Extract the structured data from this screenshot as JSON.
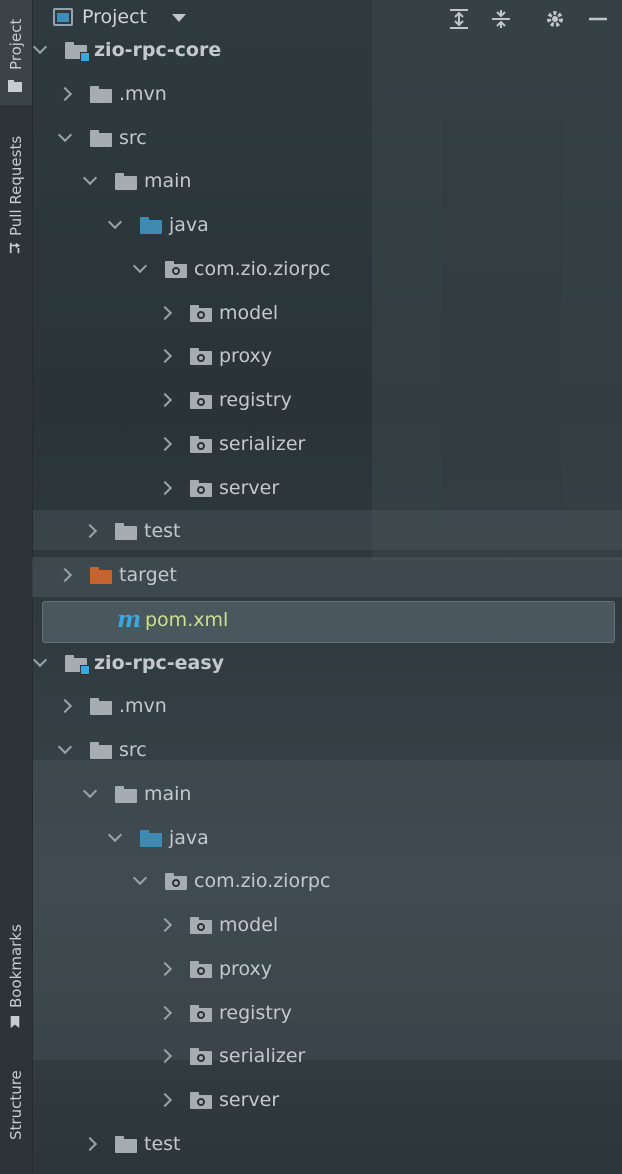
{
  "window": {
    "title": "Project"
  },
  "side_tabs": {
    "project": "Project",
    "pull_requests": "Pull Requests",
    "bookmarks": "Bookmarks",
    "structure": "Structure"
  },
  "header": {
    "icons": [
      "expand-all-icon",
      "collapse-all-icon",
      "gear-icon",
      "minimize-icon"
    ]
  },
  "tree": [
    {
      "label": "zio-rpc-core",
      "kind": "module",
      "expanded": true
    },
    {
      "label": ".mvn",
      "kind": "folder",
      "expanded": false
    },
    {
      "label": "src",
      "kind": "folder",
      "expanded": true
    },
    {
      "label": "main",
      "kind": "folder",
      "expanded": true
    },
    {
      "label": "java",
      "kind": "source-folder",
      "expanded": true
    },
    {
      "label": "com.zio.ziorpc",
      "kind": "package",
      "expanded": true
    },
    {
      "label": "model",
      "kind": "package",
      "expanded": false
    },
    {
      "label": "proxy",
      "kind": "package",
      "expanded": false
    },
    {
      "label": "registry",
      "kind": "package",
      "expanded": false
    },
    {
      "label": "serializer",
      "kind": "package",
      "expanded": false
    },
    {
      "label": "server",
      "kind": "package",
      "expanded": false
    },
    {
      "label": "test",
      "kind": "folder",
      "expanded": false
    },
    {
      "label": "target",
      "kind": "excluded-folder",
      "expanded": false
    },
    {
      "label": "pom.xml",
      "kind": "maven-file",
      "selected": true,
      "icon_glyph": "m"
    },
    {
      "label": "zio-rpc-easy",
      "kind": "module",
      "expanded": true
    },
    {
      "label": ".mvn",
      "kind": "folder",
      "expanded": false
    },
    {
      "label": "src",
      "kind": "folder",
      "expanded": true
    },
    {
      "label": "main",
      "kind": "folder",
      "expanded": true
    },
    {
      "label": "java",
      "kind": "source-folder",
      "expanded": true
    },
    {
      "label": "com.zio.ziorpc",
      "kind": "package",
      "expanded": true
    },
    {
      "label": "model",
      "kind": "package",
      "expanded": false
    },
    {
      "label": "proxy",
      "kind": "package",
      "expanded": false
    },
    {
      "label": "registry",
      "kind": "package",
      "expanded": false
    },
    {
      "label": "serializer",
      "kind": "package",
      "expanded": false
    },
    {
      "label": "server",
      "kind": "package",
      "expanded": false
    },
    {
      "label": "test",
      "kind": "folder",
      "expanded": false
    }
  ],
  "colors": {
    "accent": "#3aa7e0",
    "source_folder": "#3f8ab0",
    "excluded_folder": "#c4642f",
    "xml_file": "#cfe08a"
  }
}
